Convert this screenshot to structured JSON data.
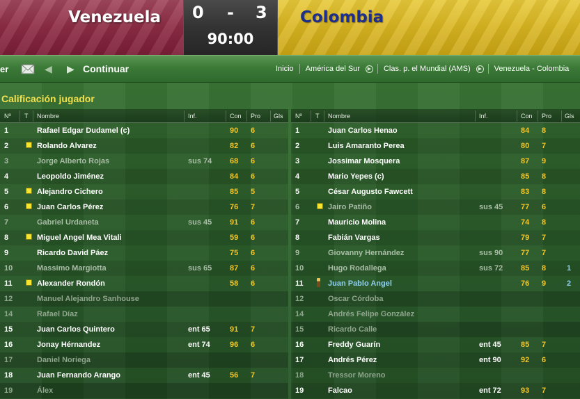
{
  "match": {
    "home_team": "Venezuela",
    "away_team": "Colombia",
    "home_score": "0",
    "separator": "-",
    "away_score": "3",
    "time": "90:00",
    "home_color": "#8d2c45",
    "away_color": "#d9b521"
  },
  "nav": {
    "prev_label": "er",
    "mail_icon": "envelope-icon",
    "back_icon": "chevron-left-icon",
    "forward_icon": "chevron-right-icon",
    "continue_label": "Continuar",
    "breadcrumb": [
      "Inicio",
      "América del Sur",
      "Clas. p. el Mundial (AMS)",
      "Venezuela - Colombia"
    ]
  },
  "section_title": "Calificación jugador",
  "columns": {
    "num": "Nº",
    "tag": "T",
    "name": "Nombre",
    "inf": "Inf.",
    "con": "Con",
    "pro": "Pro",
    "gls": "Gls"
  },
  "home_players": [
    {
      "num": "1",
      "card": "",
      "name": "Rafael Edgar Dudamel (c)",
      "inf": "",
      "con": "90",
      "pro": "6",
      "gls": "",
      "state": "played"
    },
    {
      "num": "2",
      "card": "yellow",
      "name": "Rolando Alvarez",
      "inf": "",
      "con": "82",
      "pro": "6",
      "gls": "",
      "state": "played"
    },
    {
      "num": "3",
      "card": "",
      "name": "Jorge Alberto Rojas",
      "inf": "sus 74",
      "con": "68",
      "pro": "6",
      "gls": "",
      "state": "sub"
    },
    {
      "num": "4",
      "card": "",
      "name": "Leopoldo Jiménez",
      "inf": "",
      "con": "84",
      "pro": "6",
      "gls": "",
      "state": "played"
    },
    {
      "num": "5",
      "card": "yellow",
      "name": "Alejandro Cichero",
      "inf": "",
      "con": "85",
      "pro": "5",
      "gls": "",
      "state": "played"
    },
    {
      "num": "6",
      "card": "yellow",
      "name": "Juan Carlos Pérez",
      "inf": "",
      "con": "76",
      "pro": "7",
      "gls": "",
      "state": "played"
    },
    {
      "num": "7",
      "card": "",
      "name": "Gabriel Urdaneta",
      "inf": "sus 45",
      "con": "91",
      "pro": "6",
      "gls": "",
      "state": "sub"
    },
    {
      "num": "8",
      "card": "yellow",
      "name": "Miguel Angel Mea Vitali",
      "inf": "",
      "con": "59",
      "pro": "6",
      "gls": "",
      "state": "played"
    },
    {
      "num": "9",
      "card": "",
      "name": "Ricardo David Páez",
      "inf": "",
      "con": "75",
      "pro": "6",
      "gls": "",
      "state": "played"
    },
    {
      "num": "10",
      "card": "",
      "name": "Massimo Margiotta",
      "inf": "sus 65",
      "con": "87",
      "pro": "6",
      "gls": "",
      "state": "sub"
    },
    {
      "num": "11",
      "card": "yellow",
      "name": "Alexander Rondón",
      "inf": "",
      "con": "58",
      "pro": "6",
      "gls": "",
      "state": "played"
    },
    {
      "num": "12",
      "card": "",
      "name": "Manuel Alejandro Sanhouse",
      "inf": "",
      "con": "",
      "pro": "",
      "gls": "",
      "state": "unused"
    },
    {
      "num": "14",
      "card": "",
      "name": "Rafael Díaz",
      "inf": "",
      "con": "",
      "pro": "",
      "gls": "",
      "state": "unused"
    },
    {
      "num": "15",
      "card": "",
      "name": "Juan Carlos Quintero",
      "inf": "ent 65",
      "con": "91",
      "pro": "7",
      "gls": "",
      "state": "played"
    },
    {
      "num": "16",
      "card": "",
      "name": "Jonay Hérnandez",
      "inf": "ent 74",
      "con": "96",
      "pro": "6",
      "gls": "",
      "state": "played"
    },
    {
      "num": "17",
      "card": "",
      "name": "Daniel Noriega",
      "inf": "",
      "con": "",
      "pro": "",
      "gls": "",
      "state": "unused"
    },
    {
      "num": "18",
      "card": "",
      "name": "Juan Fernando Arango",
      "inf": "ent 45",
      "con": "56",
      "pro": "7",
      "gls": "",
      "state": "played"
    },
    {
      "num": "19",
      "card": "",
      "name": "Álex",
      "inf": "",
      "con": "",
      "pro": "",
      "gls": "",
      "state": "unused"
    }
  ],
  "away_players": [
    {
      "num": "1",
      "card": "",
      "name": "Juan Carlos Henao",
      "inf": "",
      "con": "84",
      "pro": "8",
      "gls": "",
      "state": "played"
    },
    {
      "num": "2",
      "card": "",
      "name": "Luis Amaranto Perea",
      "inf": "",
      "con": "80",
      "pro": "7",
      "gls": "",
      "state": "played"
    },
    {
      "num": "3",
      "card": "",
      "name": "Jossimar Mosquera",
      "inf": "",
      "con": "87",
      "pro": "9",
      "gls": "",
      "state": "played"
    },
    {
      "num": "4",
      "card": "",
      "name": "Mario Yepes (c)",
      "inf": "",
      "con": "85",
      "pro": "8",
      "gls": "",
      "state": "played"
    },
    {
      "num": "5",
      "card": "",
      "name": "César Augusto Fawcett",
      "inf": "",
      "con": "83",
      "pro": "8",
      "gls": "",
      "state": "played"
    },
    {
      "num": "6",
      "card": "yellow",
      "name": "Jairo Patiño",
      "inf": "sus 45",
      "con": "77",
      "pro": "6",
      "gls": "",
      "state": "sub"
    },
    {
      "num": "7",
      "card": "",
      "name": "Mauricio Molina",
      "inf": "",
      "con": "74",
      "pro": "8",
      "gls": "",
      "state": "played"
    },
    {
      "num": "8",
      "card": "",
      "name": "Fabián Vargas",
      "inf": "",
      "con": "79",
      "pro": "7",
      "gls": "",
      "state": "played"
    },
    {
      "num": "9",
      "card": "",
      "name": "Giovanny Hernández",
      "inf": "sus 90",
      "con": "77",
      "pro": "7",
      "gls": "",
      "state": "sub"
    },
    {
      "num": "10",
      "card": "",
      "name": "Hugo Rodallega",
      "inf": "sus 72",
      "con": "85",
      "pro": "8",
      "gls": "1",
      "state": "sub"
    },
    {
      "num": "11",
      "card": "star",
      "name": "Juan Pablo Angel",
      "inf": "",
      "con": "76",
      "pro": "9",
      "gls": "2",
      "state": "star"
    },
    {
      "num": "12",
      "card": "",
      "name": "Oscar Córdoba",
      "inf": "",
      "con": "",
      "pro": "",
      "gls": "",
      "state": "unused"
    },
    {
      "num": "14",
      "card": "",
      "name": "Andrés Felipe González",
      "inf": "",
      "con": "",
      "pro": "",
      "gls": "",
      "state": "unused"
    },
    {
      "num": "15",
      "card": "",
      "name": "Ricardo Calle",
      "inf": "",
      "con": "",
      "pro": "",
      "gls": "",
      "state": "unused"
    },
    {
      "num": "16",
      "card": "",
      "name": "Freddy Guarín",
      "inf": "ent 45",
      "con": "85",
      "pro": "7",
      "gls": "",
      "state": "played"
    },
    {
      "num": "17",
      "card": "",
      "name": "Andrés Pérez",
      "inf": "ent 90",
      "con": "92",
      "pro": "6",
      "gls": "",
      "state": "played"
    },
    {
      "num": "18",
      "card": "",
      "name": "Tressor Moreno",
      "inf": "",
      "con": "",
      "pro": "",
      "gls": "",
      "state": "unused"
    },
    {
      "num": "19",
      "card": "",
      "name": "Falcao",
      "inf": "ent 72",
      "con": "93",
      "pro": "7",
      "gls": "",
      "state": "played"
    }
  ]
}
